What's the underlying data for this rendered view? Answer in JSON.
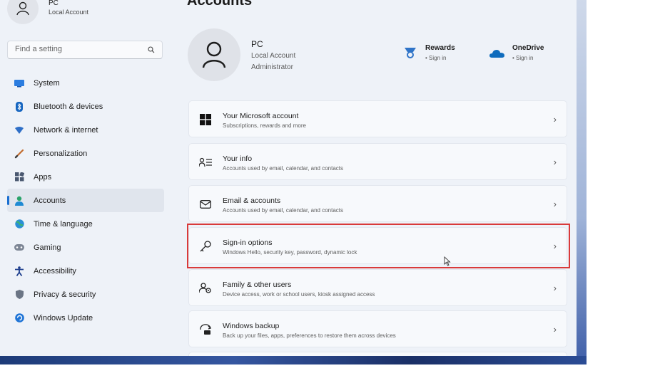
{
  "header": {
    "user_name": "PC",
    "account_type": "Local Account"
  },
  "search": {
    "placeholder": "Find a setting"
  },
  "nav": {
    "items": [
      {
        "label": "System",
        "icon": "system-icon"
      },
      {
        "label": "Bluetooth & devices",
        "icon": "bluetooth-icon"
      },
      {
        "label": "Network & internet",
        "icon": "network-icon"
      },
      {
        "label": "Personalization",
        "icon": "personalization-icon"
      },
      {
        "label": "Apps",
        "icon": "apps-icon"
      },
      {
        "label": "Accounts",
        "icon": "accounts-icon",
        "active": true
      },
      {
        "label": "Time & language",
        "icon": "time-language-icon"
      },
      {
        "label": "Gaming",
        "icon": "gaming-icon"
      },
      {
        "label": "Accessibility",
        "icon": "accessibility-icon"
      },
      {
        "label": "Privacy & security",
        "icon": "privacy-icon"
      },
      {
        "label": "Windows Update",
        "icon": "windows-update-icon"
      }
    ]
  },
  "main": {
    "title": "Accounts",
    "profile": {
      "name": "PC",
      "type": "Local Account",
      "role": "Administrator"
    },
    "services": [
      {
        "title": "Rewards",
        "status": "• Sign in",
        "icon": "rewards-icon"
      },
      {
        "title": "OneDrive",
        "status": "• Sign in",
        "icon": "onedrive-icon"
      }
    ],
    "cards": [
      {
        "title": "Your Microsoft account",
        "subtitle": "Subscriptions, rewards and more",
        "icon": "microsoft-logo-icon"
      },
      {
        "title": "Your info",
        "subtitle": "Accounts used by email, calendar, and contacts",
        "icon": "your-info-icon"
      },
      {
        "title": "Email & accounts",
        "subtitle": "Accounts used by email, calendar, and contacts",
        "icon": "email-icon"
      },
      {
        "title": "Sign-in options",
        "subtitle": "Windows Hello, security key, password, dynamic lock",
        "icon": "key-icon"
      },
      {
        "title": "Family & other users",
        "subtitle": "Device access, work or school users, kiosk assigned access",
        "icon": "family-icon"
      },
      {
        "title": "Windows backup",
        "subtitle": "Back up your files, apps, preferences to restore them across devices",
        "icon": "backup-icon"
      }
    ]
  },
  "colors": {
    "accent": "#1a6fd1",
    "highlight": "#d93a3a"
  }
}
